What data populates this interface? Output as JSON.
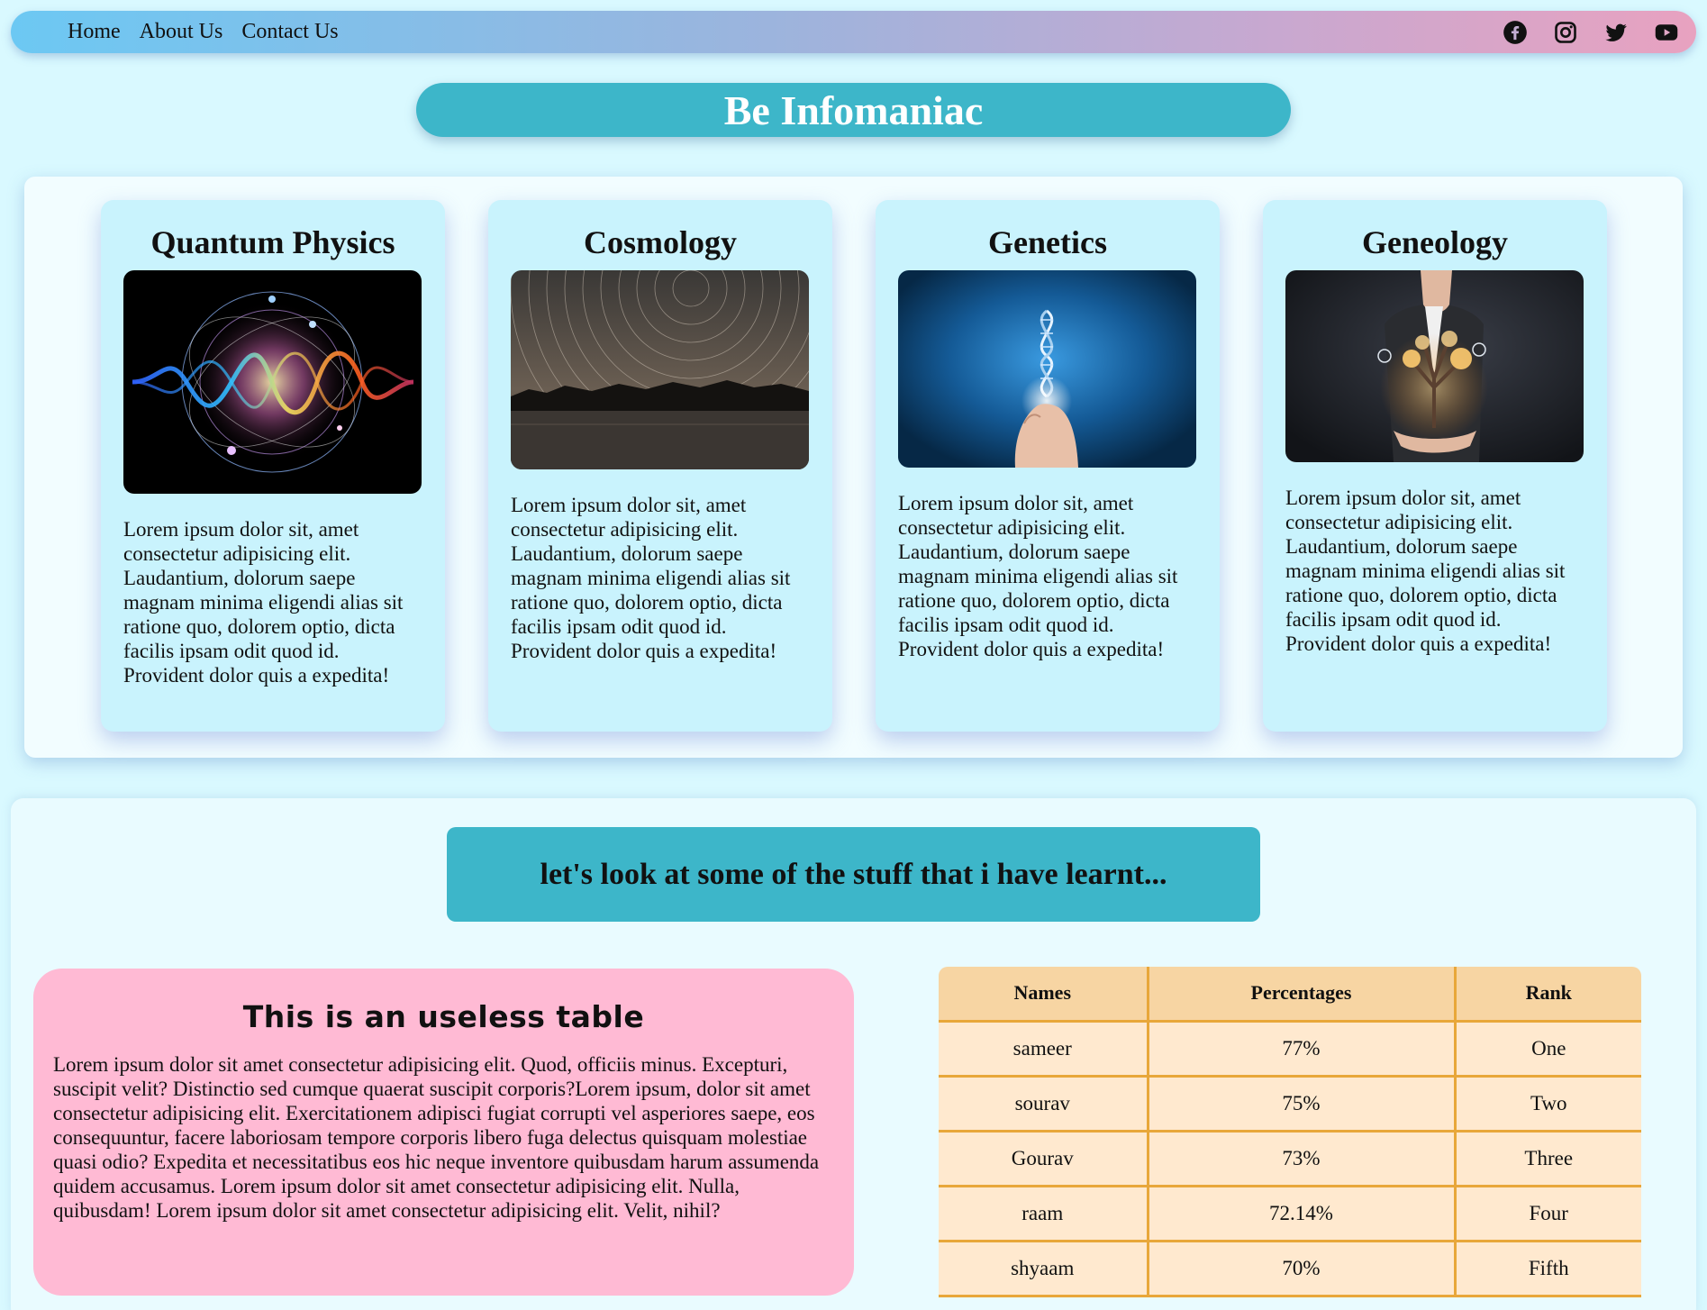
{
  "nav": {
    "links": [
      "Home",
      "About Us",
      "Contact Us"
    ],
    "social_icons": [
      "facebook-icon",
      "instagram-icon",
      "twitter-icon",
      "youtube-icon"
    ]
  },
  "banner": {
    "title": "Be Infomaniac"
  },
  "cards": [
    {
      "title": "Quantum Physics",
      "image": "quantum-physics-image",
      "text": "Lorem ipsum dolor sit, amet consectetur adipisicing elit. Laudantium, dolorum saepe magnam minima eligendi alias sit ratione quo, dolorem optio, dicta facilis ipsam odit quod id. Provident dolor quis a expedita!"
    },
    {
      "title": "Cosmology",
      "image": "cosmology-image",
      "text": "Lorem ipsum dolor sit, amet consectetur adipisicing elit. Laudantium, dolorum saepe magnam minima eligendi alias sit ratione quo, dolorem optio, dicta facilis ipsam odit quod id. Provident dolor quis a expedita!"
    },
    {
      "title": "Genetics",
      "image": "genetics-image",
      "text": "Lorem ipsum dolor sit, amet consectetur adipisicing elit. Laudantium, dolorum saepe magnam minima eligendi alias sit ratione quo, dolorem optio, dicta facilis ipsam odit quod id. Provident dolor quis a expedita!"
    },
    {
      "title": "Geneology",
      "image": "geneology-image",
      "text": "Lorem ipsum dolor sit, amet consectetur adipisicing elit. Laudantium, dolorum saepe magnam minima eligendi alias sit ratione quo, dolorem optio, dicta facilis ipsam odit quod id. Provident dolor quis a expedita!"
    }
  ],
  "learnt": {
    "heading": "let's look at some of the stuff that i have learnt...",
    "box_title": "This is an useless table",
    "box_text": "Lorem ipsum dolor sit amet consectetur adipisicing elit. Quod, officiis minus. Excepturi, suscipit velit? Distinctio sed cumque quaerat suscipit corporis?Lorem ipsum, dolor sit amet consectetur adipisicing elit. Exercitationem adipisci fugiat corrupti vel asperiores saepe, eos consequuntur, facere laboriosam tempore corporis libero fuga delectus quisquam molestiae quasi odio? Expedita et necessitatibus eos hic neque inventore quibusdam harum assumenda quidem accusamus. Lorem ipsum dolor sit amet consectetur adipisicing elit. Nulla, quibusdam! Lorem ipsum dolor sit amet consectetur adipisicing elit. Velit, nihil?"
  },
  "table": {
    "headers": [
      "Names",
      "Percentages",
      "Rank"
    ],
    "rows": [
      [
        "sameer",
        "77%",
        "One"
      ],
      [
        "sourav",
        "75%",
        "Two"
      ],
      [
        "Gourav",
        "73%",
        "Three"
      ],
      [
        "raam",
        "72.14%",
        "Four"
      ],
      [
        "shyaam",
        "70%",
        "Fifth"
      ]
    ]
  },
  "colors": {
    "background": "#d9f9ff",
    "banner": "#3db6c9",
    "card": "#c9f3fd",
    "pink_box": "#ffbad4",
    "table_header": "#f7d5a3",
    "table_cell": "#ffe9cf",
    "table_border": "#e8a73a"
  }
}
